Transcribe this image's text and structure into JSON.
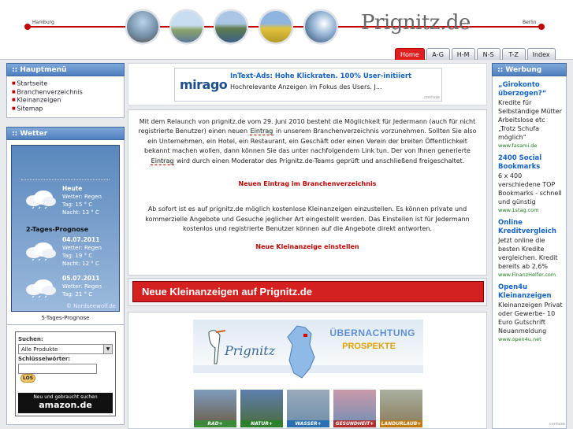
{
  "header": {
    "left_city": "Hamburg",
    "right_city": "Berlin",
    "logo": "Prignitz.de",
    "tabs": [
      "Home",
      "A-G",
      "H-M",
      "N-S",
      "T-Z",
      "Index"
    ],
    "active_tab": "Home"
  },
  "menu": {
    "title": ":: Hauptmenü",
    "items": [
      "Startseite",
      "Branchenverzeichnis",
      "Kleinanzeigen",
      "Sitemap"
    ]
  },
  "weather": {
    "title": ":: Wetter",
    "today": {
      "heading": "Heute",
      "weather": "Wetter: Regen",
      "day": "Tag: 15 ° C",
      "night": "Nacht: 13 ° C"
    },
    "two_day_label": "2-Tages-Prognose",
    "day1": {
      "heading": "04.07.2011",
      "weather": "Wetter: Regen",
      "day": "Tag: 19 ° C",
      "night": "Nacht: 12 ° C"
    },
    "day2": {
      "heading": "05.07.2011",
      "weather": "Wetter: Regen",
      "day": "Tag: 21 ° C"
    },
    "credit": "© Nordseewolf.de",
    "five_day_link": "5-Tages-Prognose"
  },
  "amazon": {
    "search_label": "Suchen:",
    "select_value": "Alle Produkte",
    "keywords_label": "Schlüsselwörter:",
    "go_label": "LOS",
    "brand_line": "Neu und gebraucht suchen",
    "brand_name": "amazon.de"
  },
  "ads": {
    "brand": "mirago",
    "title": "InText-Ads: Hohe Klickraten. 100% User-initiiert",
    "text": "Hochrelevante Anzeigen im Fokus des Users. J...",
    "footer": "contaxe"
  },
  "main": {
    "p1_a": "Mit dem Relaunch von prignitz.de vom 29. Juni 2010 besteht die Möglichkeit für Jedermann (auch für nicht registrierte Benutzer) einen neuen ",
    "p1_link1": "Eintrag",
    "p1_b": " in unserem Branchenverzeichnis vorzunehmen. Sollten Sie also ein Unternehmen, ein Hotel, ein Restaurant, ein Geschäft oder einen Verein der breiten Öffentlichkeit bekannt machen wollen, dann können Sie das unter nachfolgendem Link tun. Der von Ihnen generierte ",
    "p1_link2": "Eintrag",
    "p1_c": " wird durch einen Moderator des Prignitz.de-Teams geprüft und anschließend freigeschaltet.",
    "link_new_entry": "Neuen Eintrag im Branchenverzeichnis",
    "p2": "Ab sofort ist es auf prignitz.de möglich kostenlose Kleinanzeigen einzustellen. Es können private und kommerzielle Angebote und Gesuche jeglicher Art eingestellt werden. Das Einstellen ist für Jedermann kostenlos und registrierte Benutzer können auf die Angebote direkt antworten.",
    "link_new_ad": "Neue Kleinanzeige einstellen"
  },
  "banner": {
    "text": "Neue Kleinanzeigen auf Prignitz.de"
  },
  "promo": {
    "ueber": "ÜBERNACHTUNG",
    "prospekte": "PROSPEKTE",
    "brand": "Prignitz",
    "thumbs": [
      "RAD+",
      "NATUR+",
      "WASSER+",
      "GESUNDHEIT+",
      "LANDURLAUB+"
    ]
  },
  "werbung": {
    "title": ":: Werbung",
    "ads": [
      {
        "title": "„Girokonto überzogen?“",
        "text": "Kredite für Selbständige Mütter Arbeitslose etc „Trotz Schufa möglich“",
        "url": "www.fasami.de"
      },
      {
        "title": "2400 Social Bookmarks",
        "text": "6 x 400 verschiedene TOP Bookmarks - schnell und günstig",
        "url": "www.1stag.com"
      },
      {
        "title": "Online Kreditvergleich",
        "text": "Jetzt online die besten Kredite vergleichen. Kredit bereits ab 2,6%",
        "url": "www.FinanzHelfer.com"
      },
      {
        "title": "Open4u Kleinanzeigen",
        "text": "Kleinanzeigen Privat oder Gewerbe- 10 Euro Gutschrift Neuanmeldung",
        "url": "www.open4u.net"
      }
    ],
    "footer": "contaxe"
  }
}
